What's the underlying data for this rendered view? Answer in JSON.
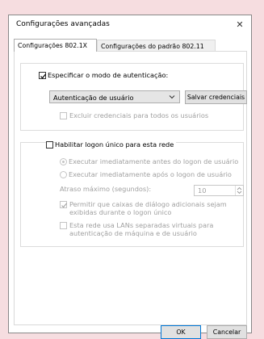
{
  "dialog": {
    "title": "Configurações avançadas",
    "close_glyph": "✕"
  },
  "tabs": [
    {
      "label": "Configurações 802.1X",
      "active": true
    },
    {
      "label": "Configurações do padrão 802.11",
      "active": false
    }
  ],
  "auth_section": {
    "specify_label": "Especificar o modo de autenticação:",
    "specify_checked": true,
    "mode_value": "Autenticação de usuário",
    "save_button": "Salvar credenciais",
    "delete_label": "Excluir credenciais para todos os usuários",
    "delete_checked": false
  },
  "sso_section": {
    "enable_label": "Habilitar logon único para esta rede",
    "enable_checked": false,
    "before_label": "Executar imediatamente antes do logon de usuário",
    "before_selected": true,
    "after_label": "Executar imediatamente após o logon de usuário",
    "after_selected": false,
    "delay_label": "Atraso máximo (segundos):",
    "delay_value": "10",
    "allow_dialogs_line1": "Permitir que caixas de diálogo adicionais sejam",
    "allow_dialogs_line2": "exibidas durante o logon único",
    "allow_dialogs_checked": true,
    "vlan_line1": "Esta rede usa LANs separadas virtuais para",
    "vlan_line2": "autenticação de máquina e de usuário",
    "vlan_checked": false
  },
  "footer": {
    "ok_label": "OK",
    "cancel_label": "Cancelar"
  },
  "colors": {
    "background": "#f6dde0",
    "disabled_text": "#a0a0a0",
    "button_face": "#e1e1e1"
  }
}
